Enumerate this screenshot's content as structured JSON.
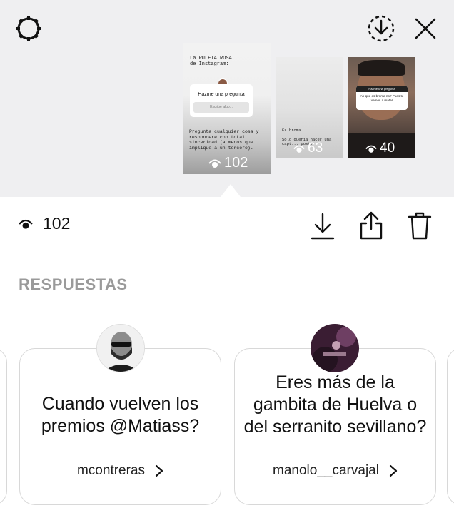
{
  "header": {
    "settings_icon": "settings-gear-icon",
    "download_icon": "save-circle-icon",
    "close_icon": "close-icon"
  },
  "stories": [
    {
      "title_line1": "La RULETA ROSA",
      "title_line2": "de Instagram:",
      "question_label": "Hazme una pregunta",
      "input_placeholder": "Escribe algo...",
      "body": "Pregunta cualquier cosa y responderé con total sinceridad (a menos que implique a un tercero).",
      "views": "102"
    },
    {
      "line1": "Es broma.",
      "line2": "Solo quería hacer una",
      "line3": "capt... post.",
      "views": "63"
    },
    {
      "card_title": "Hazme una pregunta",
      "card_text": "Ah que es broma no? Pues te vamos a matar",
      "views": "40"
    }
  ],
  "action_bar": {
    "views_count": "102",
    "eye_icon": "eye-icon",
    "download_icon": "download-icon",
    "share_icon": "share-icon",
    "delete_icon": "trash-icon"
  },
  "responses": {
    "section_title": "RESPUESTAS",
    "cards": [
      {
        "question": "Cuando vuelven los premios @Matiass?",
        "username": "mcontreras"
      },
      {
        "question": "Eres más de la gambita de Huelva o del serranito sevillano?",
        "username": "manolo__carvajal"
      }
    ]
  },
  "colors": {
    "top_background": "#efeff1",
    "section_title": "#9a9a9a",
    "card_border": "#d8d8d8"
  }
}
